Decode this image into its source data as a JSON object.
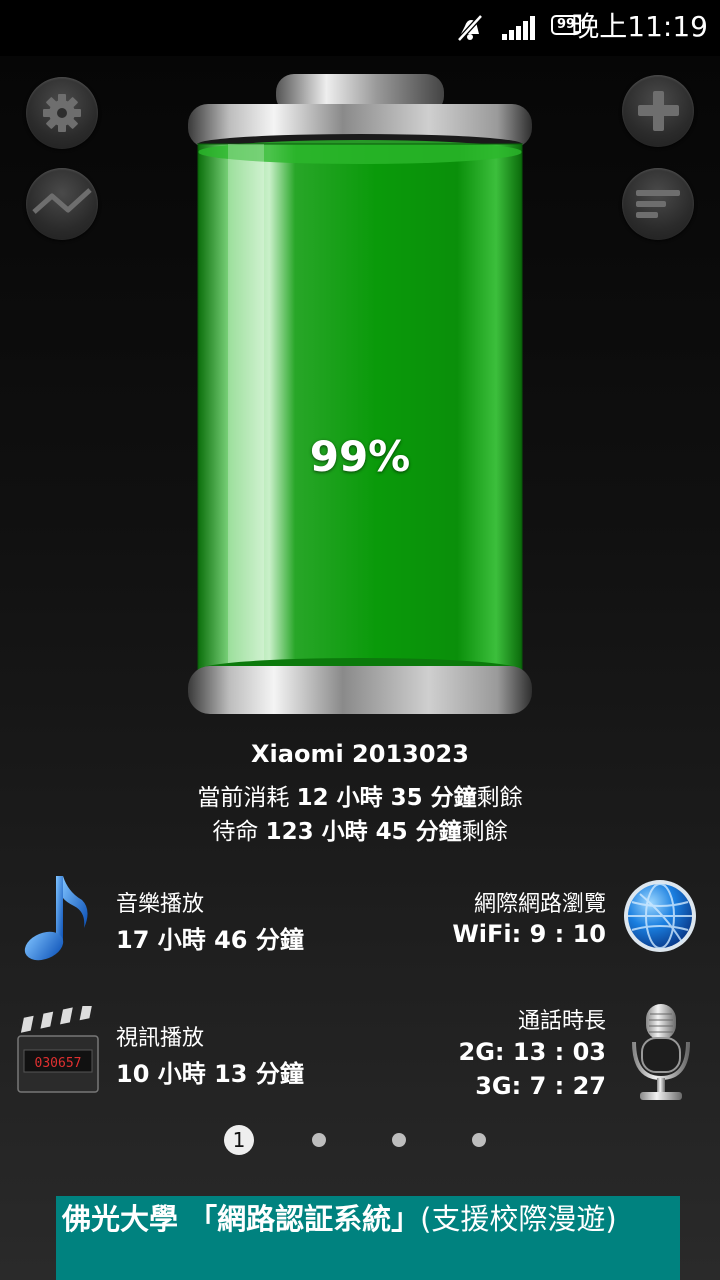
{
  "status_bar": {
    "battery_level": "99",
    "time": "晚上11:19",
    "icons": [
      "mute-icon",
      "signal-icon",
      "battery-icon"
    ]
  },
  "side_buttons": {
    "left": [
      "settings-icon",
      "chart-icon"
    ],
    "right": [
      "plus-icon",
      "list-icon"
    ]
  },
  "battery": {
    "percent_label": "99%",
    "level": 0.99,
    "fill_color": "#00a000"
  },
  "device": {
    "name": "Xiaomi 2013023",
    "current_prefix": "當前消耗 ",
    "current_time": "12 小時 35 分鐘",
    "current_suffix": "剩餘",
    "standby_prefix": "待命 ",
    "standby_time": "123 小時 45 分鐘",
    "standby_suffix": "剩餘"
  },
  "usage": {
    "music": {
      "label": "音樂播放",
      "value": "17 小時 46 分鐘",
      "icon": "music-note-icon"
    },
    "web": {
      "label": "網際網路瀏覽",
      "value": "WiFi: 9 : 10",
      "icon": "globe-icon"
    },
    "video": {
      "label": "視訊播放",
      "value": "10 小時 13 分鐘",
      "icon": "clapperboard-icon",
      "counter": "030657"
    },
    "call": {
      "label": "通話時長",
      "value_2g": "2G: 13 : 03",
      "value_3g": "3G: 7 : 27",
      "icon": "microphone-icon"
    }
  },
  "pager": {
    "current": "1",
    "total": 4
  },
  "banner": {
    "bold_text": "佛光大學 「網路認証系統」",
    "text": "(支援校際漫遊)",
    "background": "#00827f"
  }
}
